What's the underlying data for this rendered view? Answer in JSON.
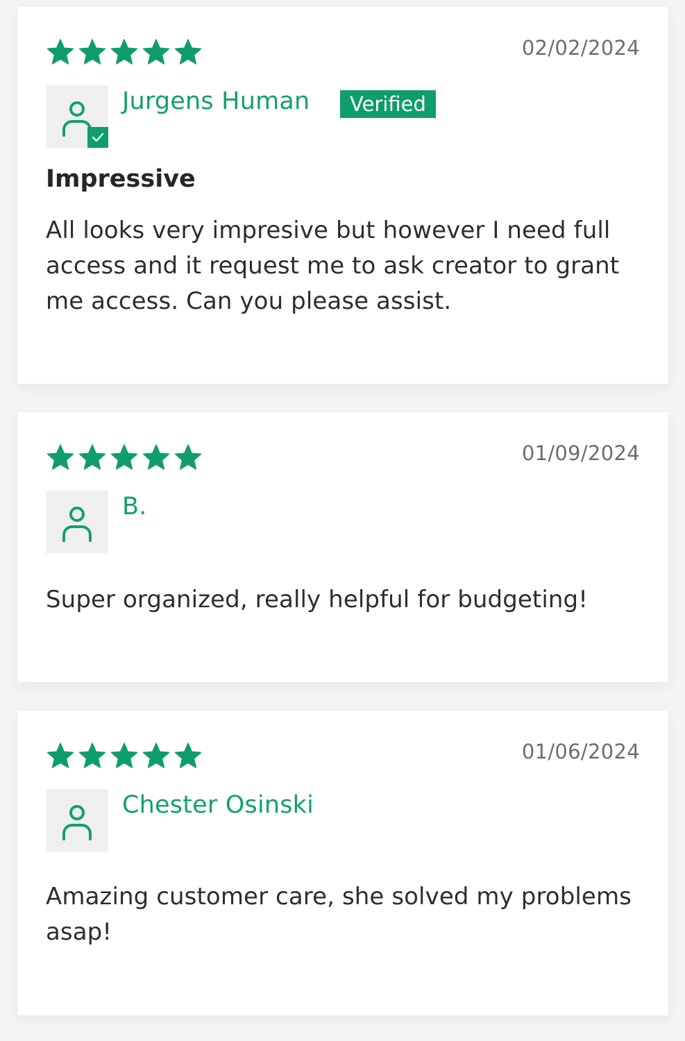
{
  "colors": {
    "accent": "#13a06e",
    "badge": "#0f9d6b",
    "text": "#2d2d2d",
    "muted": "#6d6d6d",
    "avatar_bg": "#efefef",
    "page_bg": "#f4f4f4"
  },
  "reviews": [
    {
      "rating": 5,
      "date": "02/02/2024",
      "reviewer": "Jurgens Human",
      "verified": true,
      "verified_label": "Verified",
      "title": "Impressive",
      "body": "All looks very impresive but however I need full access and it request me to ask creator to grant me access. Can you please assist.",
      "avatar_icon": "user-verified-icon"
    },
    {
      "rating": 5,
      "date": "01/09/2024",
      "reviewer": "B.",
      "verified": false,
      "title": "",
      "body": "Super organized, really helpful for budgeting!",
      "avatar_icon": "user-icon"
    },
    {
      "rating": 5,
      "date": "01/06/2024",
      "reviewer": "Chester Osinski",
      "verified": false,
      "title": "",
      "body": "Amazing customer care, she solved my problems asap!",
      "avatar_icon": "user-icon"
    }
  ]
}
